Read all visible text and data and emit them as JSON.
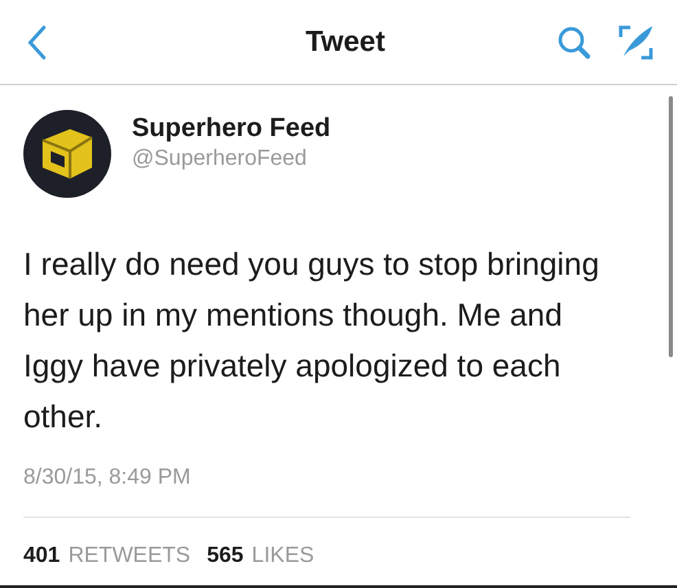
{
  "nav_bar": {
    "title": "Tweet"
  },
  "tweet": {
    "author_name": "Superhero Feed",
    "handle": "@SuperheroFeed",
    "text": "I really do need you guys to stop bringing her up in my mentions though. Me and Iggy have privately apologized to each other.",
    "timestamp": "8/30/15, 8:49 PM"
  },
  "stats": [
    {
      "count": "401",
      "label": "RETWEETS"
    },
    {
      "count": "565",
      "label": "LIKES"
    }
  ]
}
